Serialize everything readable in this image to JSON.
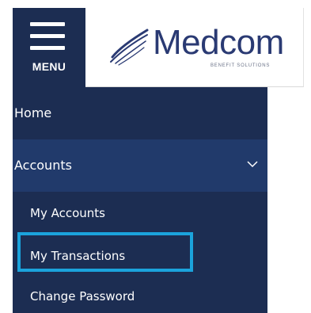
{
  "header": {
    "menu_label": "MENU",
    "brand_name": "Medcom",
    "brand_tagline": "BENEFIT SOLUTIONS",
    "brand_color": "#2a3a73",
    "menu_bg": "#1c2d52"
  },
  "sidebar": {
    "bg_color": "#1c2d52",
    "active_bg_color": "#213a6b",
    "highlight_color": "#1ba3dc",
    "items": [
      {
        "label": "Home"
      },
      {
        "label": "Accounts",
        "expanded": true,
        "icon": "chevron-down-icon"
      }
    ],
    "subitems": [
      {
        "label": "My Accounts"
      },
      {
        "label": "My Transactions",
        "highlighted": true
      },
      {
        "label": "Change Password"
      }
    ]
  }
}
